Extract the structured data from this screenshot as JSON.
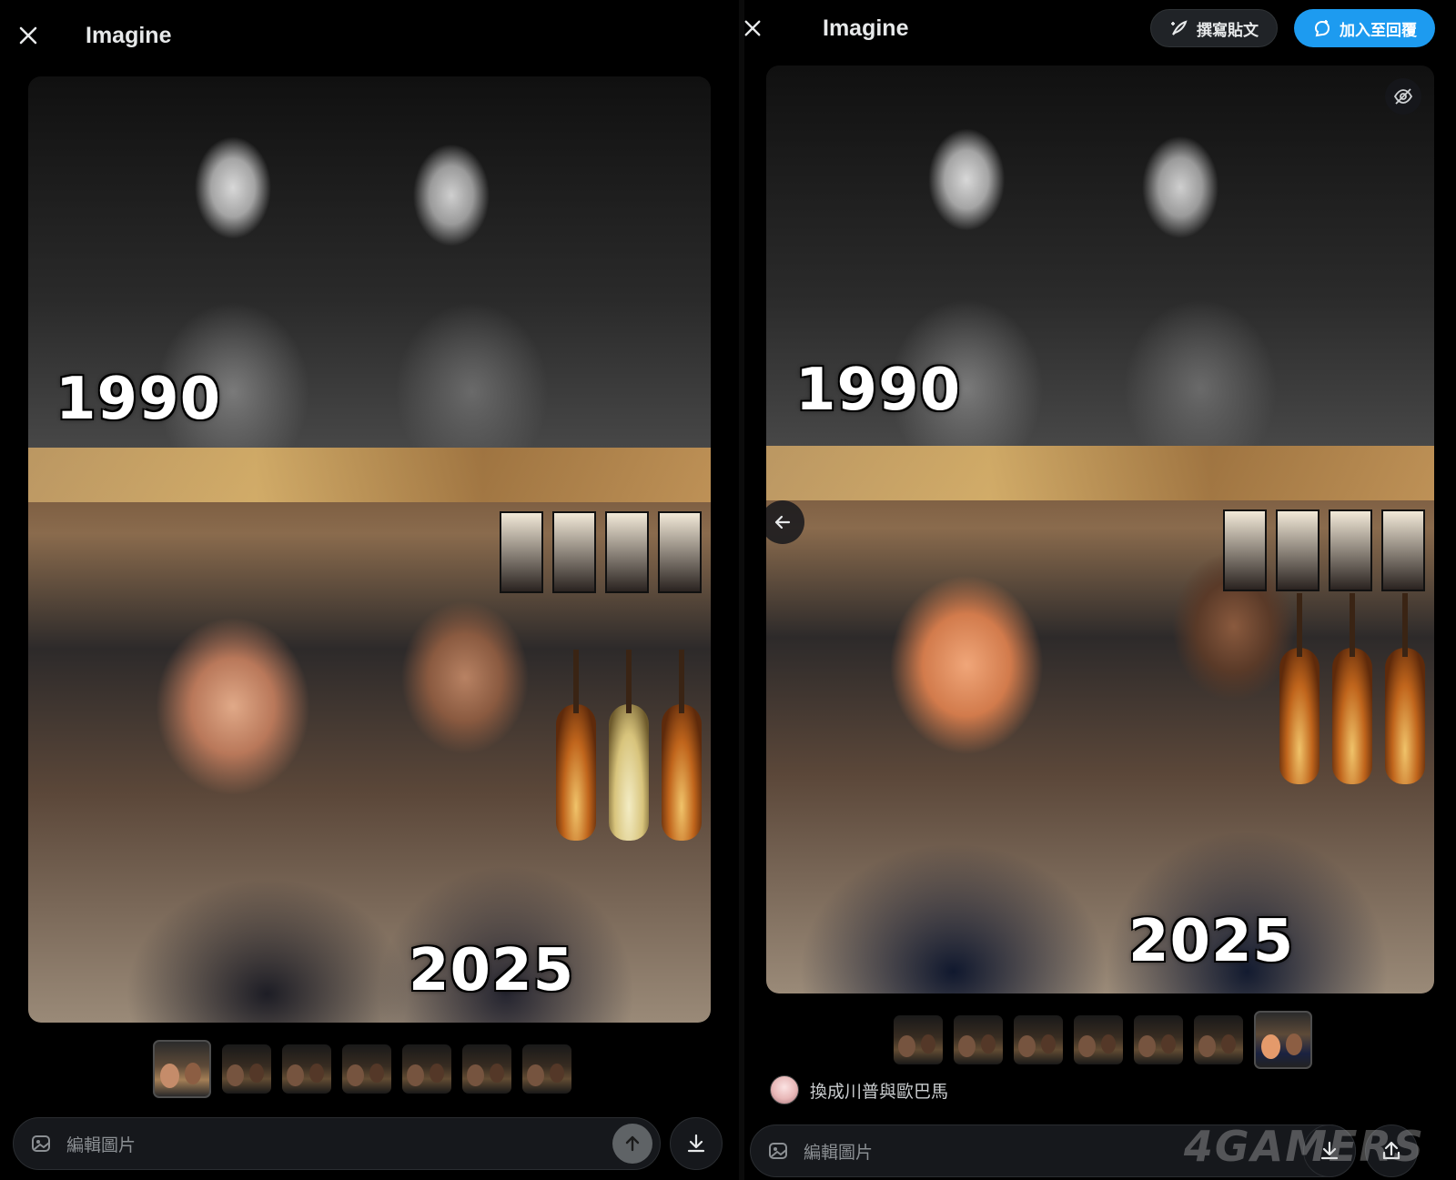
{
  "left": {
    "header": {
      "title": "Imagine"
    },
    "image": {
      "year_top": "1990",
      "year_bottom": "2025"
    },
    "thumbnails": {
      "count": 7,
      "selected_index": 0
    },
    "composer": {
      "placeholder": "編輯圖片"
    }
  },
  "right": {
    "header": {
      "title": "Imagine",
      "compose_label": "撰寫貼文",
      "reply_label": "加入至回覆"
    },
    "image": {
      "year_top": "1990",
      "year_bottom": "2025"
    },
    "thumbnails": {
      "count": 7,
      "selected_index": 6
    },
    "prompt_text": "換成川普與歐巴馬",
    "composer": {
      "placeholder": "編輯圖片"
    }
  },
  "watermark": "4GAMERS",
  "colors": {
    "accent": "#1d9bf0",
    "background": "#000000"
  }
}
